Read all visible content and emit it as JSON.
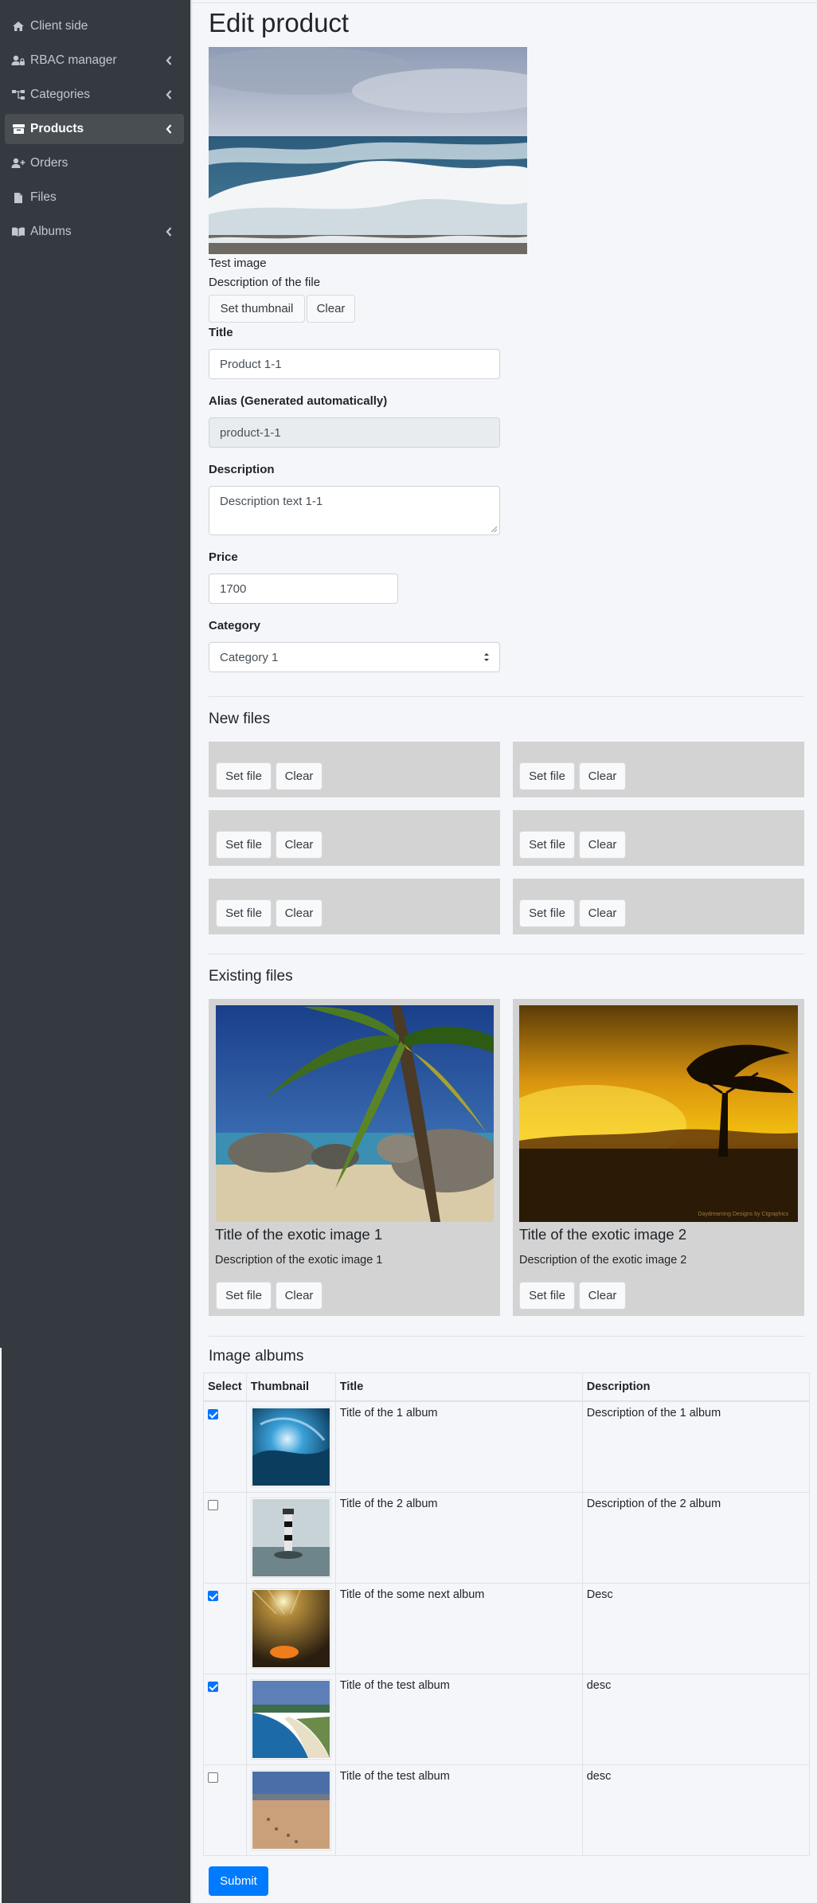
{
  "sidebar": {
    "items": [
      {
        "label": "Client side",
        "icon": "home-icon",
        "has_submenu": false,
        "active": false
      },
      {
        "label": "RBAC manager",
        "icon": "user-lock-icon",
        "has_submenu": true,
        "active": false
      },
      {
        "label": "Categories",
        "icon": "sitemap-icon",
        "has_submenu": true,
        "active": false
      },
      {
        "label": "Products",
        "icon": "box-icon",
        "has_submenu": true,
        "active": true
      },
      {
        "label": "Orders",
        "icon": "user-plus-icon",
        "has_submenu": false,
        "active": false
      },
      {
        "label": "Files",
        "icon": "file-icon",
        "has_submenu": false,
        "active": false
      },
      {
        "label": "Albums",
        "icon": "book-icon",
        "has_submenu": true,
        "active": false
      }
    ]
  },
  "page": {
    "title": "Edit product",
    "thumbnail": {
      "caption_title": "Test image",
      "caption_desc": "Description of the file",
      "set_label": "Set thumbnail",
      "clear_label": "Clear"
    },
    "form": {
      "title_label": "Title",
      "title_value": "Product 1-1",
      "alias_label": "Alias (Generated automatically)",
      "alias_value": "product-1-1",
      "description_label": "Description",
      "description_value": "Description text 1-1",
      "price_label": "Price",
      "price_value": "1700",
      "category_label": "Category",
      "category_value": "Category 1"
    },
    "new_files": {
      "heading": "New files",
      "set_label": "Set file",
      "clear_label": "Clear",
      "count": 6
    },
    "existing_files": {
      "heading": "Existing files",
      "items": [
        {
          "title": "Title of the exotic image 1",
          "description": "Description of the exotic image 1",
          "set_label": "Set file",
          "clear_label": "Clear"
        },
        {
          "title": "Title of the exotic image 2",
          "description": "Description of the exotic image 2",
          "set_label": "Set file",
          "clear_label": "Clear"
        }
      ],
      "image2_watermark": "Daydreaming Designs by Ctgraphics"
    },
    "albums": {
      "heading": "Image albums",
      "columns": [
        "Select",
        "Thumbnail",
        "Title",
        "Description"
      ],
      "rows": [
        {
          "selected": true,
          "title": "Title of the 1 album",
          "description": "Description of the 1 album"
        },
        {
          "selected": false,
          "title": "Title of the 2 album",
          "description": "Description of the 2 album"
        },
        {
          "selected": true,
          "title": "Title of the some next album",
          "description": "Desc"
        },
        {
          "selected": true,
          "title": "Title of the test album",
          "description": "desc"
        },
        {
          "selected": false,
          "title": "Title of the test album",
          "description": "desc"
        }
      ]
    },
    "submit_label": "Submit"
  },
  "colors": {
    "sidebar_bg": "#343a40",
    "sidebar_active_bg": "#494e53",
    "page_bg": "#f4f6f9",
    "primary": "#007bff",
    "file_box_bg": "#d3d3d3"
  }
}
